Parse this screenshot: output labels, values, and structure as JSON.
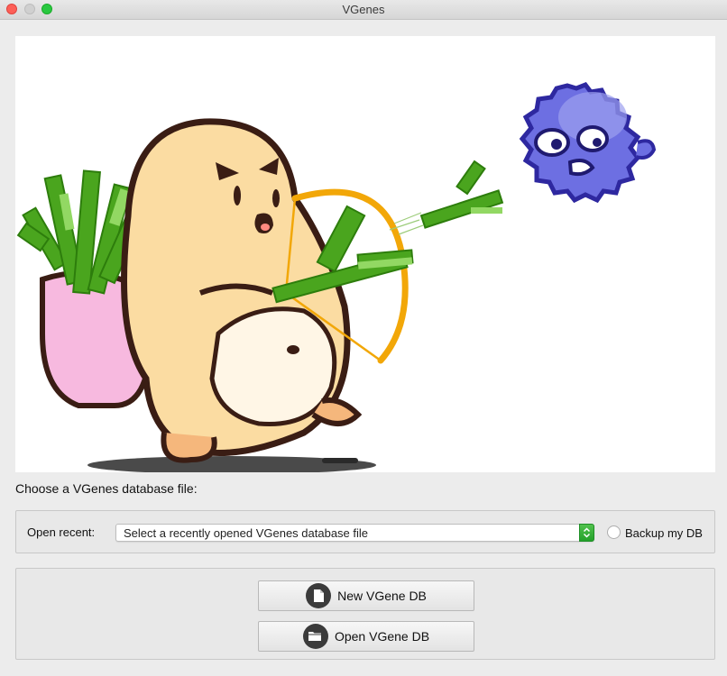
{
  "window": {
    "title": "VGenes"
  },
  "prompt": {
    "text": "Choose a VGenes database file:"
  },
  "recent": {
    "label": "Open recent:",
    "combo_value": "Select a recently opened VGenes database file",
    "backup_label": "Backup my DB",
    "backup_checked": false
  },
  "actions": {
    "new_label": "New VGene DB",
    "open_label": "Open VGene DB"
  },
  "icons": {
    "new": "document-icon",
    "open": "folder-icon"
  },
  "colors": {
    "accent": "#23a12a",
    "button_icon_bg": "#3b3b3b",
    "close": "#fd5f57",
    "maximize": "#29c840"
  }
}
